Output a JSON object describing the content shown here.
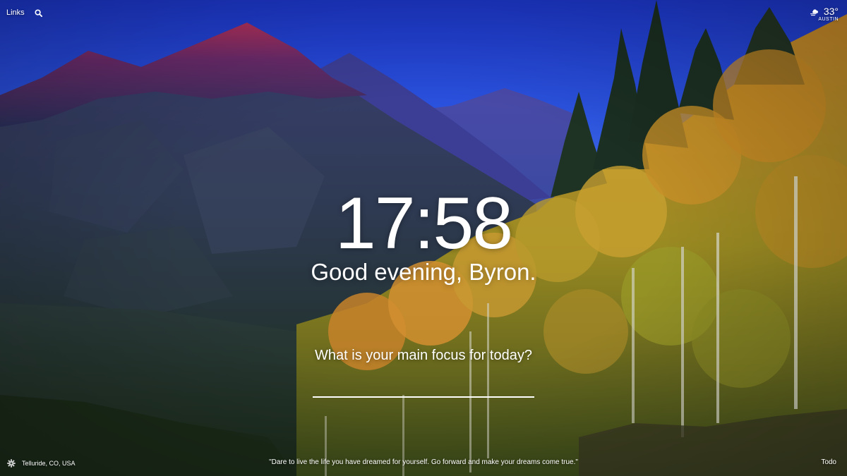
{
  "nav": {
    "links_label": "Links",
    "search_icon": "search-icon"
  },
  "weather": {
    "icon": "wind-cloud-icon",
    "temperature": "33°",
    "location": "AUSTIN"
  },
  "clock": {
    "time": "17:58"
  },
  "greeting": {
    "text": "Good evening, Byron."
  },
  "focus": {
    "prompt": "What is your main focus for today?",
    "value": ""
  },
  "footer": {
    "settings_icon": "gear-icon",
    "photo_location": "Telluride, CO, USA",
    "quote": "\"Dare to live the life you have dreamed for yourself. Go forward and make your dreams come true.\"",
    "todo_label": "Todo"
  }
}
